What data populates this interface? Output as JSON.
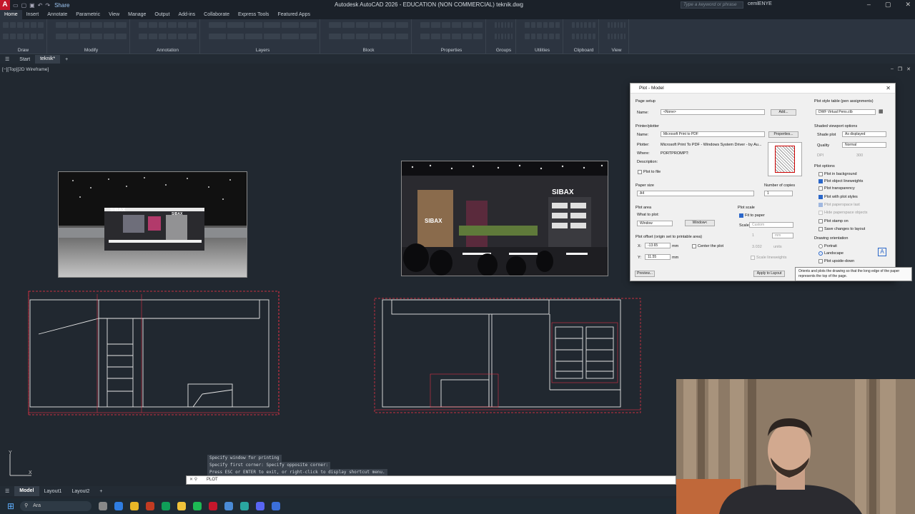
{
  "app": {
    "title": "Autodesk AutoCAD 2026 - EDUCATION (NON COMMERCIAL)   teknik.dwg",
    "logo": "A",
    "share": "Share",
    "search_placeholder": "Type a keyword or phrase",
    "user": "cemlENYE"
  },
  "ribbon_tabs": [
    "Home",
    "Insert",
    "Annotate",
    "Parametric",
    "View",
    "Manage",
    "Output",
    "Add-ins",
    "Collaborate",
    "Express Tools",
    "Featured Apps"
  ],
  "ribbon_groups": [
    "Draw",
    "Modify",
    "Annotation",
    "Layers",
    "Block",
    "Properties",
    "Groups",
    "Utilities",
    "Clipboard",
    "View"
  ],
  "doc_tabs": {
    "start": "Start",
    "active": "teknik*"
  },
  "viewport": {
    "label": "[−][Top][2D Wireframe]"
  },
  "renders": {
    "left_brand": "SIBAX",
    "right_brand": "SIBAX"
  },
  "plot": {
    "title": "Plot - Model",
    "page_setup": "Page setup",
    "name_label": "Name:",
    "page_setup_value": "<None>",
    "add": "Add...",
    "printer_section": "Printer/plotter",
    "printer_value": "Microsoft Print to PDF",
    "properties": "Properties...",
    "plotter_label": "Plotter:",
    "plotter_value": "Microsoft Print To PDF - Windows System Driver - by Au...",
    "where_label": "Where:",
    "where_value": "PORTPROMPT:",
    "desc_label": "Description:",
    "plot_to_file": "Plot to file",
    "paper_size_label": "Paper size",
    "paper_size": "A4",
    "copies_label": "Number of copies",
    "copies": "1",
    "plot_area": "Plot area",
    "what_to_plot": "What to plot:",
    "what_value": "Window",
    "window_btn": "Window<",
    "plot_scale": "Plot scale",
    "fit_to_paper": "Fit to paper",
    "scale_label": "Scale:",
    "scale_value": "Custom",
    "scale_num": "1",
    "scale_unit": "mm",
    "scale_den": "3.032",
    "scale_unit2": "units",
    "scale_lineweights": "Scale lineweights",
    "offset_label": "Plot offset (origin set to printable area)",
    "x_label": "X:",
    "x_value": "-13.65",
    "y_label": "Y:",
    "y_value": "11.55",
    "mm": "mm",
    "center": "Center the plot",
    "preview": "Preview...",
    "apply": "Apply to Layout",
    "style_table": "Plot style table (pen assignments)",
    "style_value": "DWF Virtual Pens.ctb",
    "shaded": "Shaded viewport options",
    "shade_plot": "Shade plot",
    "shade_value": "As displayed",
    "quality": "Quality",
    "quality_value": "Normal",
    "dpi": "DPI",
    "dpi_value": "300",
    "options": "Plot options",
    "opt_background": "Plot in background",
    "opt_lineweights": "Plot object lineweights",
    "opt_transparency": "Plot transparency",
    "opt_styles": "Plot with plot styles",
    "opt_paperspace_last": "Plot paperspace last",
    "opt_hide": "Hide paperspace objects",
    "opt_stamp": "Plot stamp on",
    "opt_save": "Save changes to layout",
    "orientation": "Drawing orientation",
    "portrait": "Portrait",
    "landscape": "Landscape",
    "upside": "Plot upside-down"
  },
  "tooltip": "Orients and plots the drawing so that the long edge of the paper represents the top of the page.",
  "command": {
    "history": [
      "Specify window for printing",
      "Specify first corner: Specify opposite corner:",
      "Press ESC or ENTER to exit, or right-click to display shortcut menu."
    ],
    "current": "PLOT"
  },
  "layout_tabs": [
    "Model",
    "Layout1",
    "Layout2"
  ],
  "taskbar": {
    "search": "Ara"
  }
}
